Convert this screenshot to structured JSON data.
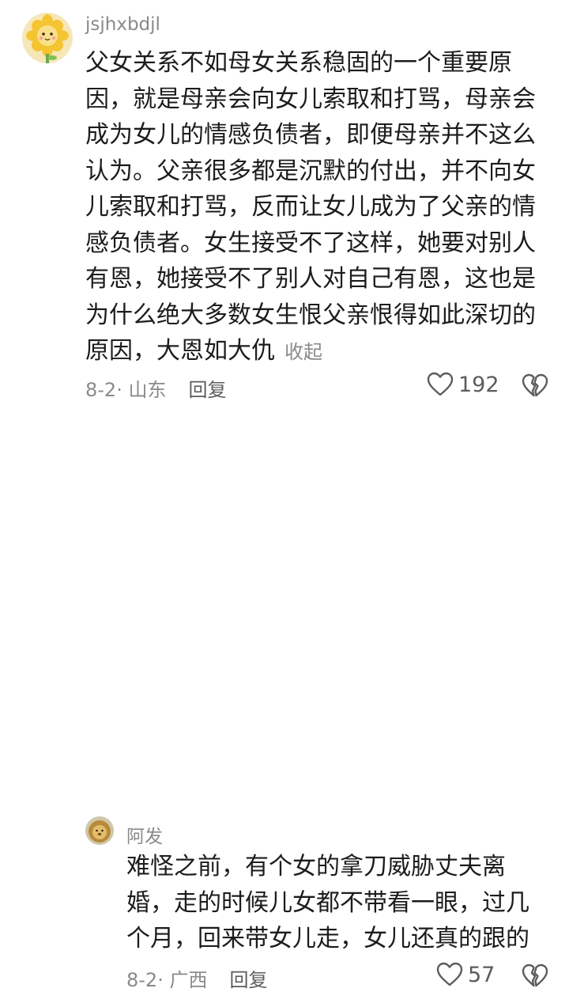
{
  "comments": [
    {
      "username": "jsjhxbdjl",
      "avatar_icon": "sunflower-avatar",
      "body_lines": [
        "父女关系不如母女关系稳固的一个重要原",
        "因，就是母亲会向女儿索取和打骂，母亲会",
        "成为女儿的情感负债者，即便母亲并不这么",
        "认为。父亲很多都是沉默的付出，并不向女",
        "儿索取和打骂，反而让女儿成为了父亲的情",
        "感负债者。女生接受不了这样，她要对别人",
        "有恩，她接受不了别人对自己有恩，这也是",
        "为什么绝大多数女生恨父亲恨得如此深切的",
        "原因，大恩如大仇"
      ],
      "collapse_label": "收起",
      "date_location": "8-2· 山东",
      "reply_label": "回复",
      "like_count": "192"
    },
    {
      "username": "阿发",
      "avatar_icon": "lion-avatar",
      "body_lines": [
        "难怪之前，有个女的拿刀威胁丈夫离",
        "婚，走的时候儿女都不带看一眼，过几",
        "个月，回来带女儿走，女儿还真的跟的"
      ],
      "date_location": "8-2· 广西",
      "reply_label": "回复",
      "like_count": "57"
    }
  ],
  "colors": {
    "text": "#1c1c1c",
    "muted": "#8a8a8a",
    "secondary": "#5c5c5c",
    "background": "#ffffff"
  }
}
